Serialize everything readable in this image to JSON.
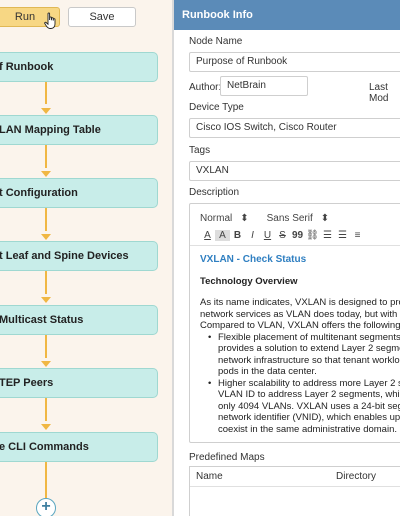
{
  "toolbar": {
    "run_label": "Run",
    "save_label": "Save"
  },
  "flow": {
    "nodes": [
      {
        "label": "f Runbook"
      },
      {
        "label": "LAN Mapping Table"
      },
      {
        "label": "t Configuration"
      },
      {
        "label": "t Leaf and Spine Devices"
      },
      {
        "label": "Multicast Status"
      },
      {
        "label": "TEP Peers"
      },
      {
        "label": "e CLI Commands"
      }
    ],
    "add_label": "+"
  },
  "panel": {
    "title": "Runbook Info",
    "node_name_label": "Node Name",
    "node_name_value": "Purpose of Runbook",
    "author_label": "Author:",
    "author_value": "NetBrain",
    "last_modified_label": "Last Mod",
    "device_type_label": "Device Type",
    "device_type_value": "Cisco IOS Switch, Cisco Router",
    "tags_label": "Tags",
    "tags_value": "VXLAN",
    "description_label": "Description"
  },
  "editor": {
    "toolbar_row1": [
      "Normal",
      "⬍",
      "Sans Serif",
      "⬍"
    ],
    "toolbar_row2": [
      "A",
      "A",
      "B",
      "I",
      "U",
      "S",
      "99",
      "⛓",
      "☰",
      "☰",
      "≡"
    ],
    "heading": "VXLAN - Check Status",
    "subheading": "Technology Overview",
    "para": [
      "As its name indicates, VXLAN is designed to provide t",
      "network services as VLAN does today, but with greate",
      "Compared to VLAN, VXLAN offers the following bene"
    ],
    "bullets": [
      [
        "Flexible placement of multitenant segments thr",
        "provides a solution to extend Layer 2 segments",
        "network infrastructure so that tenant workload c",
        "pods in the data center."
      ],
      [
        "Higher scalability to address more Layer 2 seg",
        "VLAN ID to address Layer 2 segments, which r",
        "only 4094 VLANs. VXLAN uses a 24-bit segme",
        "network identifier (VNID), which enables up to",
        "coexist in the same administrative domain."
      ]
    ]
  },
  "maps": {
    "label": "Predefined Maps",
    "columns": [
      "Name",
      "Directory"
    ]
  },
  "colors": {
    "header_bg": "#5b8bb8",
    "node_bg": "#c8ede9",
    "connector": "#f0b743",
    "run_button": "#f7d784",
    "heading_blue": "#2f7fc1"
  }
}
